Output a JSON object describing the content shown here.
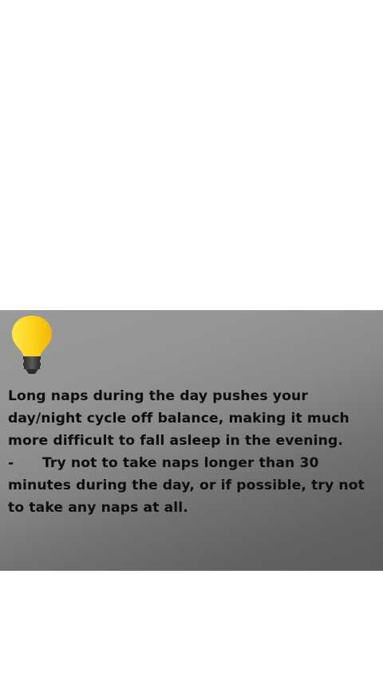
{
  "tip": {
    "icon": "lightbulb-icon",
    "paragraph": "Long naps during the day pushes your day/night cycle off balance, making it much more difficult to fall asleep in the evening.",
    "bullet_marker": "-",
    "bullet_text": "Try not to take naps longer than 30 minutes during the day, or if possible, try not to take any naps at all."
  },
  "colors": {
    "bulb_light": "#ffe84a",
    "bulb_dark": "#f2b600",
    "base_dark": "#333333"
  }
}
